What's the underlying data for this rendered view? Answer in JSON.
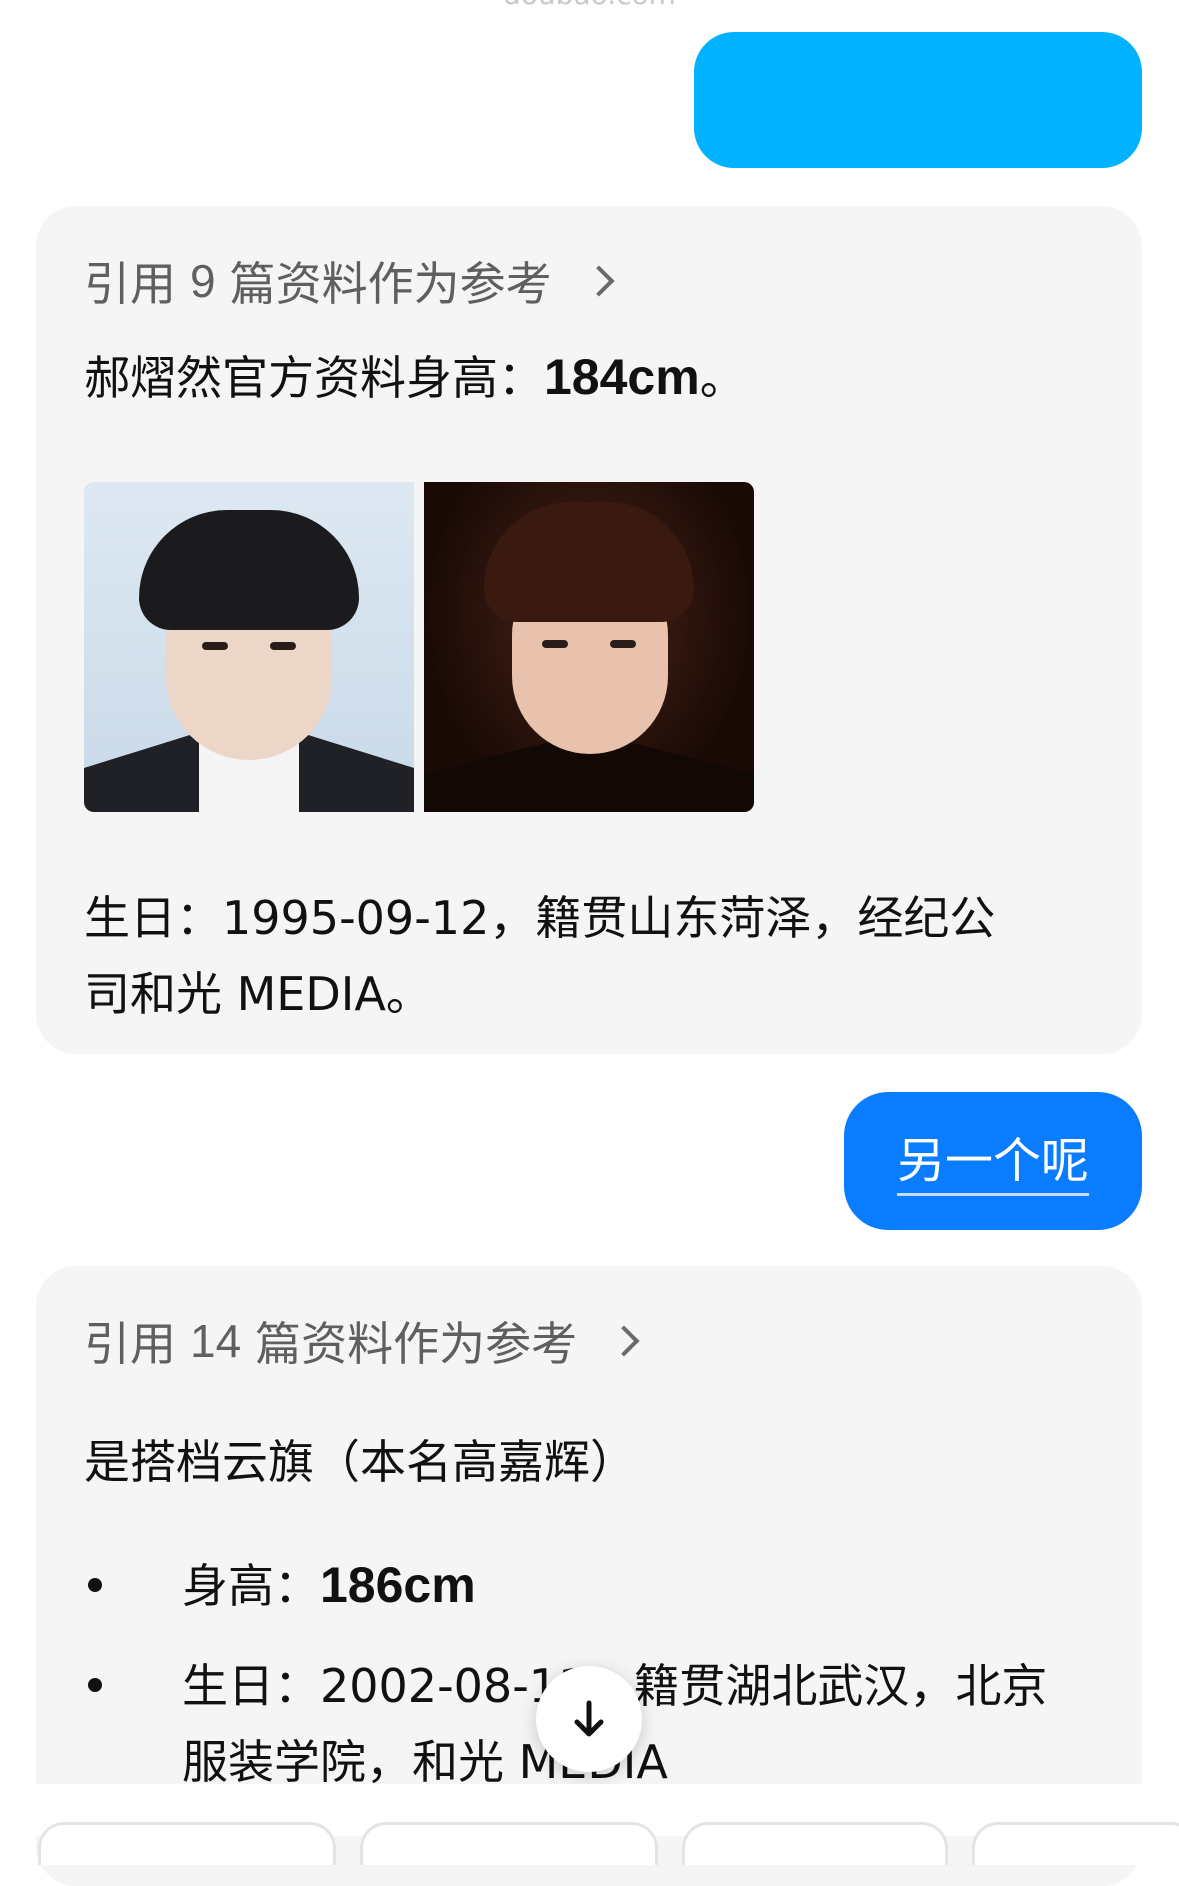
{
  "header": {
    "domain_text": "doubao.com"
  },
  "card1": {
    "ref_prefix": "引用",
    "ref_count": "9",
    "ref_suffix": "篇资料作为参考",
    "height_text": "郝熠然官方资料身高：",
    "height_value": "184cm",
    "height_end": "。",
    "bio_line1": "生日：1995-09-12，籍贯山东菏泽，经纪公",
    "bio_line2": "司和光 MEDIA。"
  },
  "user_message": {
    "text": "另一个呢"
  },
  "card2": {
    "ref_prefix": "引用",
    "ref_count": "14",
    "ref_suffix": "篇资料作为参考",
    "intro": "是搭档云旗（本名高嘉辉）",
    "bullets": [
      {
        "label": "身高：",
        "value": "186cm"
      },
      {
        "line1": "生日：2002-08-11，籍贯湖北武汉，北京",
        "line2": "服装学院，和光 MEDIA"
      }
    ]
  },
  "icons": {
    "ref_chevron": "chevron-right-icon",
    "scroll_down": "arrow-down-icon"
  },
  "colors": {
    "user_bubble": "#0a7cff",
    "top_bubble": "#00b2ff",
    "card_bg": "#f5f5f5"
  }
}
